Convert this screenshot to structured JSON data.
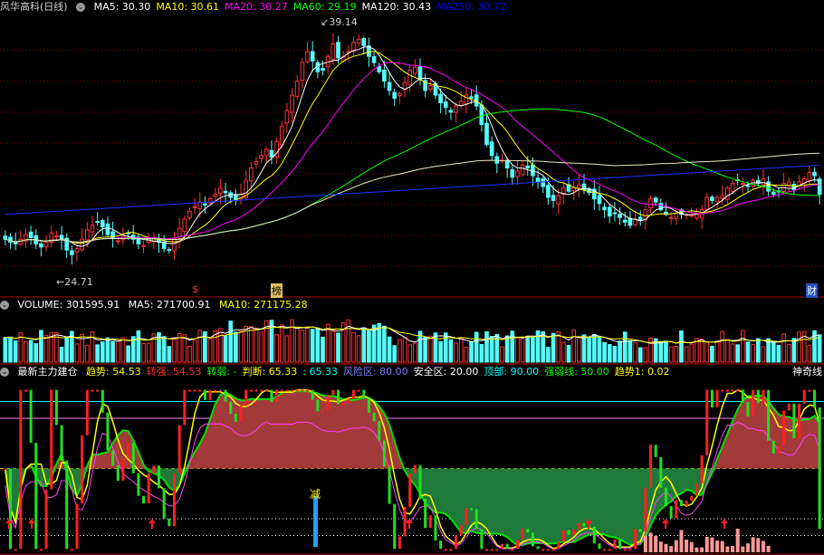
{
  "main": {
    "title": "风华高科",
    "period": "(日线)",
    "ma": [
      {
        "label": "MA5: 30.30",
        "color": "#ffffff"
      },
      {
        "label": "MA10: 30.61",
        "color": "#ffff00"
      },
      {
        "label": "MA20: 30.27",
        "color": "#ff00ff"
      },
      {
        "label": "MA60: 29.19",
        "color": "#00ff00"
      },
      {
        "label": "MA120: 30.43",
        "color": "#ffffff"
      },
      {
        "label": "MA250: 30.72",
        "color": "#0000ff"
      }
    ],
    "high_label": "39.14",
    "low_label": "24.71",
    "markers": {
      "s": "$",
      "bang": "榜",
      "cai": "财"
    }
  },
  "volume": {
    "label": "VOLUME: 301595.91",
    "ma5": "MA5: 271700.91",
    "ma10": "MA10: 271175.28"
  },
  "indicator": {
    "name": "最新主力建仓",
    "items": [
      {
        "label": "趋势: 54.53",
        "color": "#ffff00"
      },
      {
        "label": "转强: 54.53",
        "color": "#ff3030"
      },
      {
        "label": "转弱: -",
        "color": "#00ff00"
      },
      {
        "label": "判断: 65.33",
        "color": "#ffff00"
      },
      {
        "label": ": 65.33",
        "color": "#00ffff"
      },
      {
        "label": "风险区: 80.00",
        "color": "#8080ff"
      },
      {
        "label": "安全区: 20.00",
        "color": "#ffffff"
      },
      {
        "label": "顶部: 90.00",
        "color": "#00ffff"
      },
      {
        "label": "强弱线: 50.00",
        "color": "#00ff00"
      },
      {
        "label": "趋势1: 0.02",
        "color": "#ffff00"
      }
    ],
    "right_label": "神奇线",
    "jian": "减"
  },
  "colors": {
    "up": "#ff3232",
    "down": "#54fcfc",
    "grid": "#8b0000"
  },
  "chart_data": [
    {
      "type": "candlestick",
      "title": "风华高科 (日线)",
      "ylim": [
        23.5,
        40.5
      ],
      "high": 39.14,
      "low": 24.71,
      "series": [
        {
          "name": "MA5",
          "last": 30.3
        },
        {
          "name": "MA10",
          "last": 30.61
        },
        {
          "name": "MA20",
          "last": 30.27
        },
        {
          "name": "MA60",
          "last": 29.19
        },
        {
          "name": "MA120",
          "last": 30.43
        },
        {
          "name": "MA250",
          "last": 30.72
        }
      ],
      "close": [
        26.0,
        25.8,
        25.7,
        26.0,
        26.3,
        26.1,
        25.7,
        25.5,
        25.8,
        26.4,
        26.2,
        26.0,
        25.3,
        25.0,
        25.4,
        26.0,
        26.6,
        26.9,
        27.1,
        26.8,
        26.3,
        26.1,
        25.9,
        26.2,
        26.4,
        26.0,
        25.7,
        25.6,
        26.0,
        26.1,
        25.8,
        25.4,
        25.3,
        26.0,
        26.7,
        27.3,
        27.8,
        28.1,
        28.4,
        28.2,
        28.6,
        28.9,
        29.3,
        29.0,
        28.7,
        28.5,
        28.9,
        29.8,
        30.6,
        31.0,
        31.4,
        31.8,
        31.3,
        32.3,
        33.3,
        34.3,
        35.3,
        36.2,
        37.4,
        38.1,
        37.5,
        36.8,
        36.9,
        37.8,
        38.6,
        37.7,
        37.8,
        38.1,
        38.7,
        38.9,
        38.5,
        37.8,
        37.4,
        36.8,
        36.2,
        35.6,
        35.1,
        35.4,
        36.1,
        36.9,
        37.1,
        36.3,
        35.6,
        35.9,
        35.3,
        34.8,
        34.5,
        34.2,
        34.6,
        34.9,
        35.3,
        35.1,
        34.6,
        33.4,
        32.1,
        31.4,
        30.9,
        31.1,
        30.6,
        30.0,
        30.4,
        30.8,
        30.6,
        30.1,
        29.7,
        29.4,
        28.7,
        28.5,
        28.8,
        29.3,
        29.1,
        29.3,
        29.5,
        29.2,
        29.0,
        28.6,
        28.3,
        27.9,
        27.5,
        27.7,
        27.4,
        27.1,
        26.9,
        27.3,
        27.2,
        27.9,
        28.6,
        28.4,
        27.9,
        27.6,
        27.4,
        27.7,
        27.6,
        27.6,
        27.6,
        27.6,
        27.9,
        28.7,
        28.5,
        28.7,
        28.8,
        29.3,
        29.6,
        29.8,
        29.6,
        29.4,
        29.8,
        29.6,
        29.9,
        29.1,
        28.9,
        29.1,
        29.6,
        29.7,
        29.2,
        29.7,
        29.9,
        30.3,
        30.1,
        28.9
      ],
      "volume_ylim": [
        0,
        420000
      ],
      "volume_last": 301595.91,
      "volume_ma5": 271700.91,
      "volume_ma10": 271175.28
    },
    {
      "type": "line",
      "title": "最新主力建仓",
      "ylim": [
        0,
        100
      ],
      "reference_lines": {
        "风险区": 80,
        "安全区": 20,
        "顶部": 90,
        "强弱线": 50
      },
      "series": [
        {
          "name": "趋势",
          "last": 54.53
        },
        {
          "name": "判断",
          "last": 65.33
        },
        {
          "name": "趋势1",
          "last": 0.02
        }
      ]
    }
  ]
}
